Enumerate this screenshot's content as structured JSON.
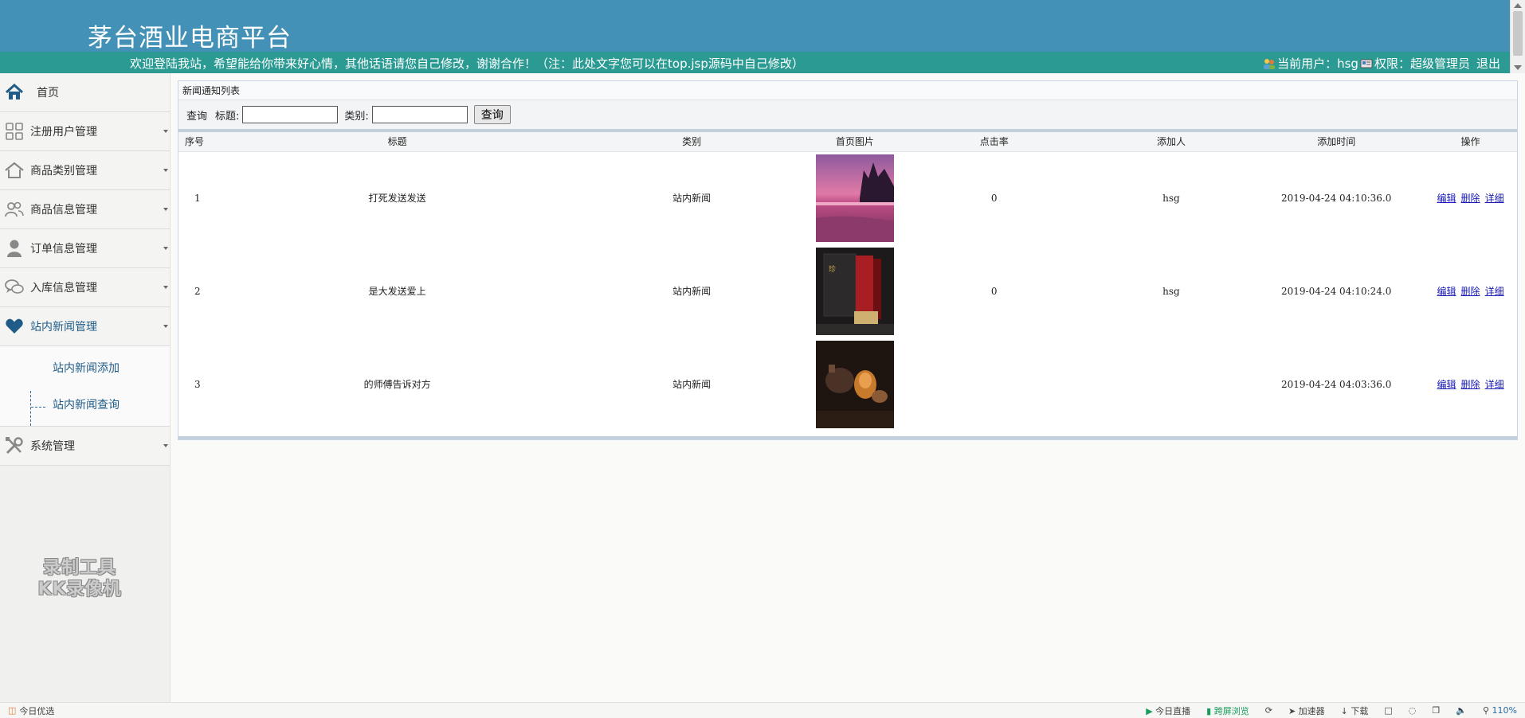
{
  "header": {
    "title": "茅台酒业电商平台",
    "welcome": "欢迎登陆我站，希望能给你带来好心情，其他话语请您自己修改，谢谢合作！（注：此处文字您可以在top.jsp源码中自己修改）",
    "current_user_label": "当前用户：hsg",
    "permission_label": "权限：超级管理员",
    "logout": "退出"
  },
  "sidebar": {
    "items": [
      {
        "label": "首页",
        "icon": "home-icon"
      },
      {
        "label": "注册用户管理",
        "icon": "grid-icon"
      },
      {
        "label": "商品类别管理",
        "icon": "house-icon"
      },
      {
        "label": "商品信息管理",
        "icon": "users-icon"
      },
      {
        "label": "订单信息管理",
        "icon": "user-icon"
      },
      {
        "label": "入库信息管理",
        "icon": "chat-icon"
      },
      {
        "label": "站内新闻管理",
        "icon": "heart-icon"
      },
      {
        "label": "系统管理",
        "icon": "tools-icon"
      }
    ],
    "submenu": [
      {
        "label": "站内新闻添加"
      },
      {
        "label": "站内新闻查询"
      }
    ],
    "watermark_line1": "录制工具",
    "watermark_line2": "KK录像机"
  },
  "main": {
    "panel_title": "新闻通知列表",
    "search": {
      "query_label": "查询",
      "title_label": "标题:",
      "category_label": "类别:",
      "title_value": "",
      "category_value": "",
      "button": "查询"
    },
    "columns": [
      "序号",
      "标题",
      "类别",
      "首页图片",
      "点击率",
      "添加人",
      "添加时间",
      "操作"
    ],
    "rows": [
      {
        "no": "1",
        "title": "打死发送发送",
        "category": "站内新闻",
        "image": "pink-lake-landscape",
        "clicks": "0",
        "author": "hsg",
        "time": "2019-04-24 04:10:36.0"
      },
      {
        "no": "2",
        "title": "是大发送爱上",
        "category": "站内新闻",
        "image": "liquor-gift-box",
        "clicks": "0",
        "author": "hsg",
        "time": "2019-04-24 04:10:24.0"
      },
      {
        "no": "3",
        "title": "的师傅告诉对方",
        "category": "站内新闻",
        "image": "tea-set-dark",
        "clicks": "",
        "author": "",
        "time": "2019-04-24 04:03:36.0"
      }
    ],
    "actions": {
      "edit": "编辑",
      "delete": "删除",
      "detail": "详细"
    }
  },
  "statusbar": {
    "left": "今日优选",
    "live": "今日直播",
    "immersive": "跨屏浏览",
    "accelerator": "加速器",
    "download": "下载",
    "zoom": "110%"
  }
}
